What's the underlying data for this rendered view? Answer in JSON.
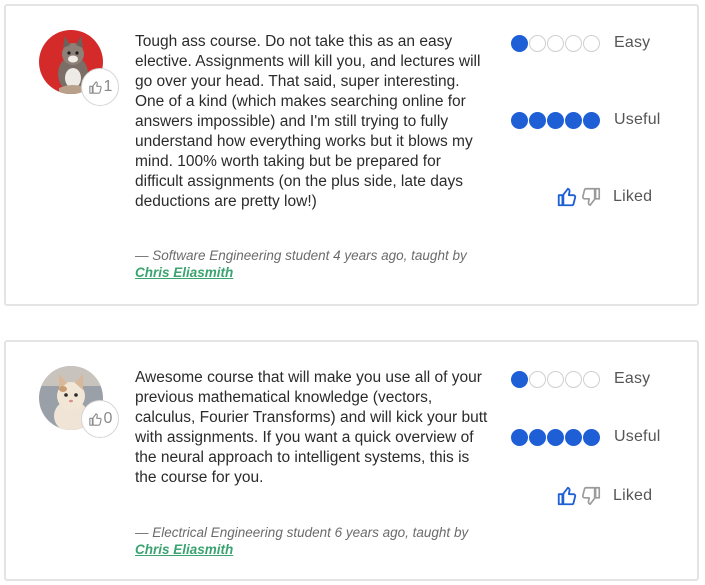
{
  "reviews": [
    {
      "upvotes": "1",
      "text": "Tough ass course. Do not take this as an easy elective. Assignments will kill you, and lectures will go over your head. That said, super interesting. One of a kind (which makes searching online for answers impossible) and I'm still trying to fully understand how everything works but it blows my mind. 100% worth taking but be prepared for difficult assignments (on the plus side, late days deductions are pretty low!)",
      "attribution_prefix": "— Software Engineering student 4 years ago, taught by ",
      "instructor": "Chris Eliasmith",
      "easy": {
        "level": 1,
        "max": 5,
        "label": "Easy"
      },
      "useful": {
        "level": 5,
        "max": 5,
        "label": "Useful"
      },
      "liked_label": "Liked",
      "avatar_bg": "#d42a2a"
    },
    {
      "upvotes": "0",
      "text": "Awesome course that will make you use all of your previous mathematical knowledge (vectors, calculus, Fourier Transforms) and will kick your butt with assignments. If you want a quick overview of the neural approach to intelligent systems, this is the course for you.",
      "attribution_prefix": "— Electrical Engineering student 6 years ago, taught by ",
      "instructor": "Chris Eliasmith",
      "easy": {
        "level": 1,
        "max": 5,
        "label": "Easy"
      },
      "useful": {
        "level": 5,
        "max": 5,
        "label": "Useful"
      },
      "liked_label": "Liked",
      "avatar_bg": "#9aa0a8"
    }
  ],
  "colors": {
    "rating_fill": "#1f5fd6",
    "instructor_link": "#3aa36f",
    "liked_thumb": "#1f5fd6"
  },
  "icons": {
    "upvote": "thumbs-up-outline-icon",
    "like": "thumbs-up-icon",
    "dislike": "thumbs-down-icon"
  }
}
